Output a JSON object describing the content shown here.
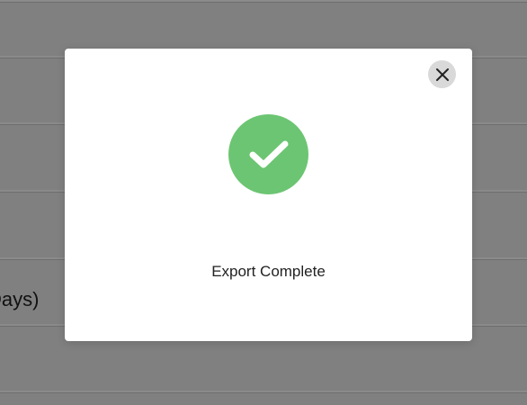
{
  "background": {
    "partial_row_text": "Days)"
  },
  "modal": {
    "message": "Export Complete",
    "status_icon": "checkmark-icon",
    "status_color": "#6cc572",
    "close_icon": "close-icon"
  }
}
